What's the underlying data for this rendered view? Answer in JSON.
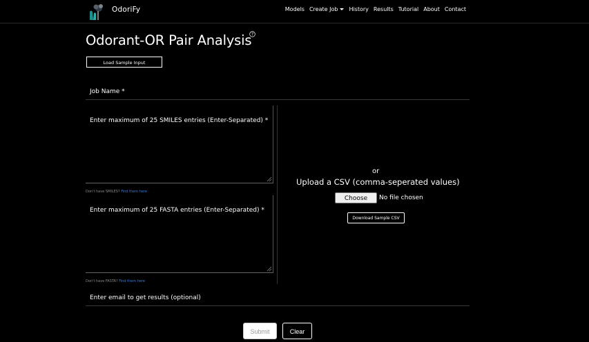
{
  "nav": {
    "brand": "OdoriFy",
    "links": [
      "Models",
      "Create Job",
      "History",
      "Results",
      "Tutorial",
      "About",
      "Contact"
    ]
  },
  "page": {
    "title": "Odorant-OR Pair Analysis",
    "load_sample_label": "Load Sample Input"
  },
  "form": {
    "job_name_label": "Job Name *",
    "smiles_label": "Enter maximum of 25 SMILES entries (Enter-Separated) *",
    "smiles_hint": "Don't have SMILES?",
    "smiles_hint_link": "Find them here",
    "fasta_label": "Enter maximum of 25 FASTA entries (Enter-Separated) *",
    "fasta_hint": "Don't have FASTA?",
    "fasta_hint_link": "Find them here",
    "email_label": "Enter email to get results (optional)"
  },
  "upload": {
    "or_label": "or",
    "title": "Upload a CSV (comma-seperated values)",
    "choose_file_label": "Choose File",
    "no_file_label": "No file chosen",
    "download_sample_label": "Download Sample CSV"
  },
  "actions": {
    "submit_label": "Submit",
    "clear_label": "Clear"
  }
}
